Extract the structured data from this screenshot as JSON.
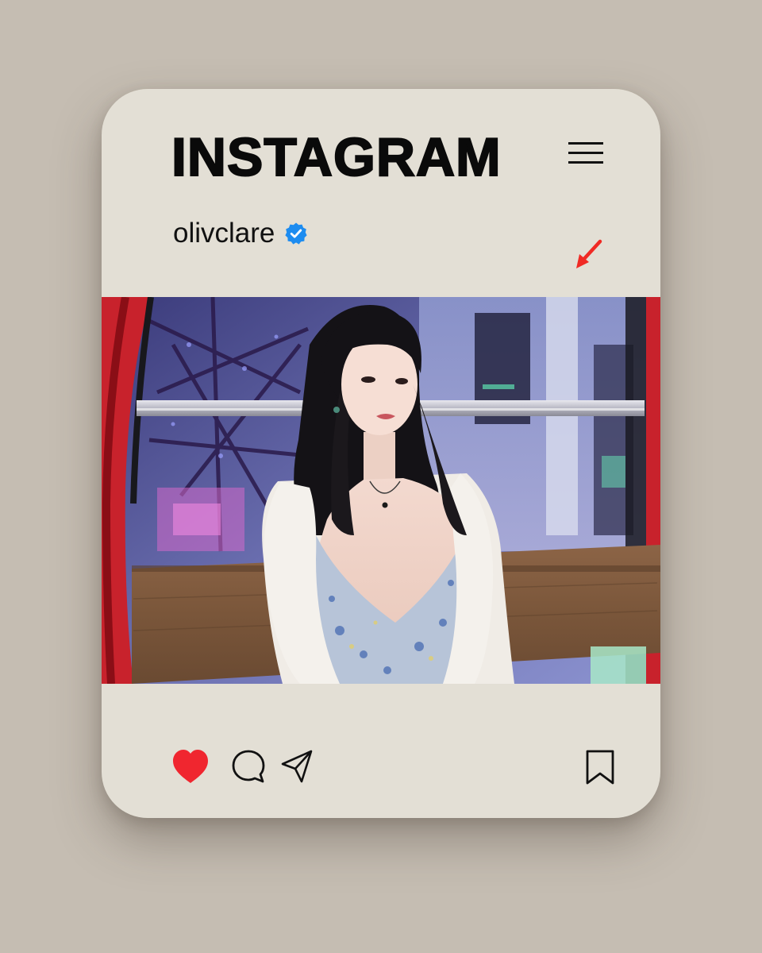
{
  "header": {
    "title": "INSTAGRAM",
    "menu_icon": "hamburger-menu-icon"
  },
  "post": {
    "username": "olivclare",
    "verified": true,
    "verified_icon": "verified-badge-icon",
    "annotation_icon": "red-arrow-icon",
    "photo_description_icon": "post-photo"
  },
  "actions": {
    "like_icon": "heart-icon",
    "liked": true,
    "comment_icon": "comment-icon",
    "share_icon": "send-icon",
    "save_icon": "bookmark-icon"
  },
  "colors": {
    "page_background": "#c5bdb2",
    "card_background": "#e3dfd5",
    "like_red": "#f0262f",
    "verified_blue": "#1d8cf0",
    "arrow_red": "#f02a24",
    "text": "#0a0a0a"
  }
}
